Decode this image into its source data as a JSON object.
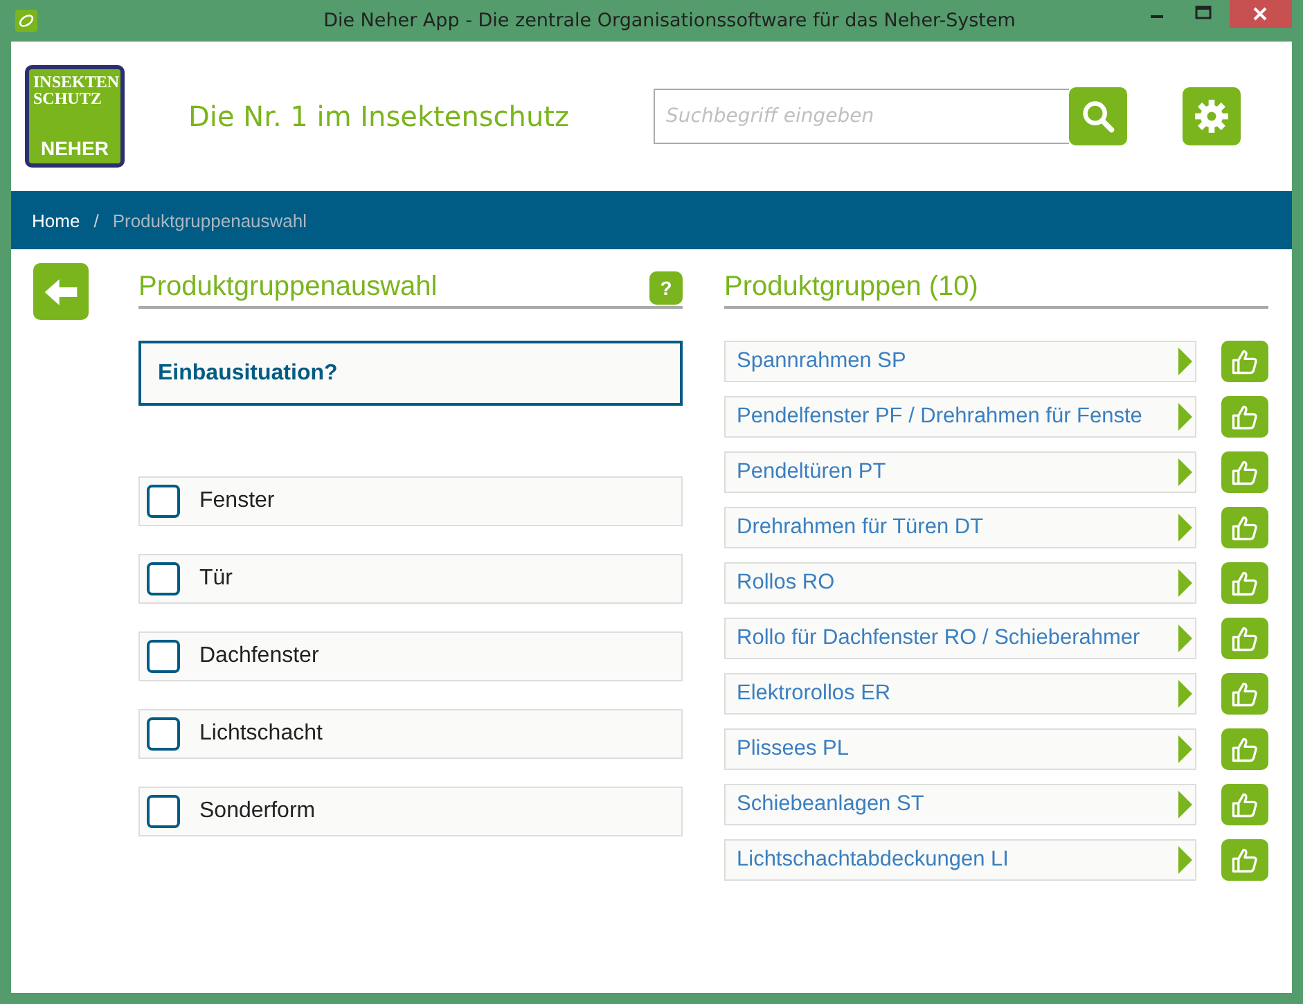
{
  "window": {
    "title": "Die Neher App - Die zentrale Organisationssoftware für das Neher-System"
  },
  "header": {
    "logo_lines": [
      "INSEKTEN",
      "SCHUTZ",
      "NEHER"
    ],
    "tagline": "Die Nr. 1 im Insektenschutz",
    "search": {
      "placeholder": "Suchbegriff eingeben"
    }
  },
  "breadcrumb_separator": "/",
  "breadcrumb": [
    {
      "label": "Home",
      "selected": false
    },
    {
      "label": "Produktgruppenauswahl",
      "selected": true
    }
  ],
  "left_panel": {
    "title": "Produktgruppenauswahl",
    "help": "?",
    "question": "Einbausituation?",
    "options": [
      {
        "label": "Fenster",
        "checked": false
      },
      {
        "label": "Tür",
        "checked": false
      },
      {
        "label": "Dachfenster",
        "checked": false
      },
      {
        "label": "Lichtschacht",
        "checked": false
      },
      {
        "label": "Sonderform",
        "checked": false
      }
    ]
  },
  "right_panel": {
    "title": "Produktgruppen (10)",
    "groups": [
      {
        "label": "Spannrahmen SP"
      },
      {
        "label": "Pendelfenster PF / Drehrahmen für Fenste"
      },
      {
        "label": "Pendeltüren PT"
      },
      {
        "label": "Drehrahmen für Türen DT"
      },
      {
        "label": "Rollos RO"
      },
      {
        "label": "Rollo für Dachfenster RO / Schieberahmer"
      },
      {
        "label": "Elektrorollos ER"
      },
      {
        "label": "Plissees PL"
      },
      {
        "label": "Schiebeanlagen ST"
      },
      {
        "label": "Lichtschachtabdeckungen LI"
      }
    ]
  }
}
